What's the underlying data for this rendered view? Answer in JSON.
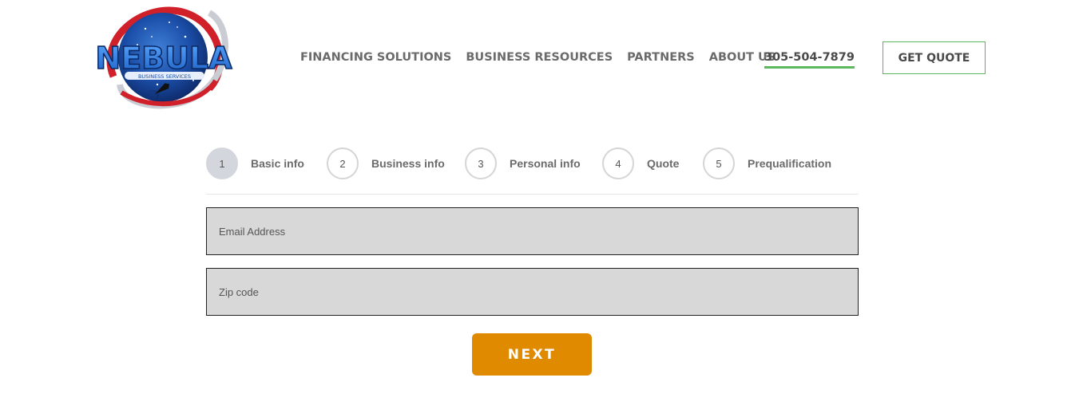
{
  "logo": {
    "brand_text": "NEBULA",
    "tagline": "BUSINESS SERVICES"
  },
  "nav": {
    "items": [
      {
        "label": "FINANCING SOLUTIONS"
      },
      {
        "label": "BUSINESS RESOURCES"
      },
      {
        "label": "PARTNERS"
      },
      {
        "label": "ABOUT US"
      }
    ],
    "phone": "305-504-7879",
    "quote_button": "GET QUOTE"
  },
  "steps": [
    {
      "number": "1",
      "label": "Basic info",
      "active": true
    },
    {
      "number": "2",
      "label": "Business info",
      "active": false
    },
    {
      "number": "3",
      "label": "Personal info",
      "active": false
    },
    {
      "number": "4",
      "label": "Quote",
      "active": false
    },
    {
      "number": "5",
      "label": "Prequalification",
      "active": false
    }
  ],
  "form": {
    "email_placeholder": "Email Address",
    "email_value": "",
    "zip_placeholder": "Zip code",
    "zip_value": "",
    "next_label": "NEXT"
  },
  "colors": {
    "accent_green": "#5cb85c",
    "next_orange": "#e08a00",
    "input_bg": "#d8d8d8",
    "nav_text": "#6b6b6b"
  }
}
